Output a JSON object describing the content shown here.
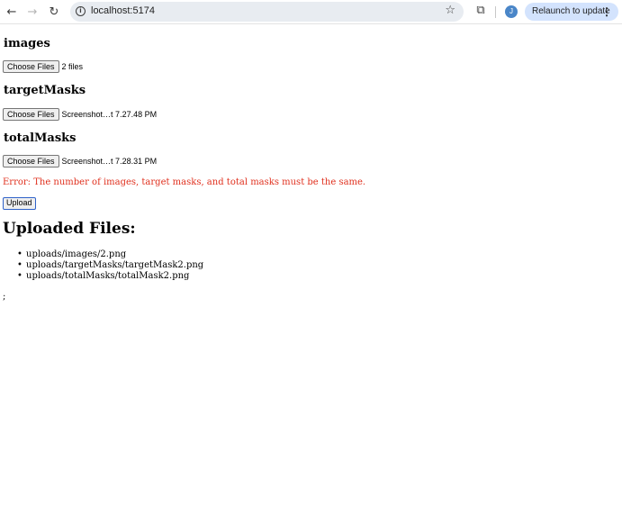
{
  "browser": {
    "url": "localhost:5174",
    "relaunch_label": "Relaunch to update",
    "avatar_letter": "J"
  },
  "form": {
    "images": {
      "heading": "images",
      "button_label": "Choose Files",
      "status": "2 files"
    },
    "targetMasks": {
      "heading": "targetMasks",
      "button_label": "Choose Files",
      "status": "Screenshot…t 7.27.48 PM"
    },
    "totalMasks": {
      "heading": "totalMasks",
      "button_label": "Choose Files",
      "status": "Screenshot…t 7.28.31 PM"
    },
    "error": "Error: The number of images, target masks, and total masks must be the same.",
    "upload_label": "Upload"
  },
  "uploaded": {
    "heading": "Uploaded Files:",
    "files": [
      "uploads/images/2.png",
      "uploads/targetMasks/targetMask2.png",
      "uploads/totalMasks/totalMask2.png"
    ]
  },
  "stray_text": ";"
}
